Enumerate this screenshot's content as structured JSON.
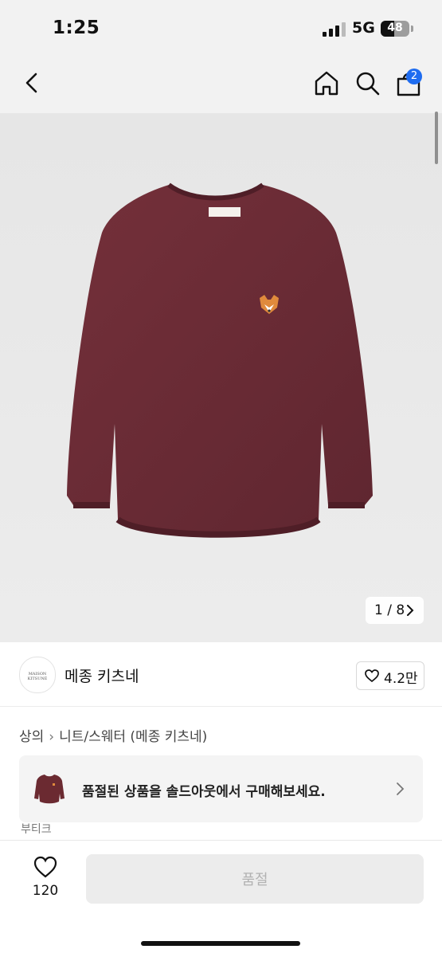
{
  "status_bar": {
    "time": "1:25",
    "network": "5G",
    "battery": "48",
    "battery_level": 0.48
  },
  "nav": {
    "cart_count": "2",
    "icons": [
      "back-icon",
      "home-icon",
      "search-icon",
      "cart-icon"
    ]
  },
  "product": {
    "image_counter": "1 / 8",
    "image_color": "#6b2a31"
  },
  "brand": {
    "name": "메종 키츠네",
    "logo_text": "MAISON KITSUNÉ",
    "likes": "4.2만"
  },
  "breadcrumb": {
    "category": "상의",
    "subcategory": "니트/스웨터 (메종 키츠네)"
  },
  "soldout_banner": {
    "text": "품절된 상품을 솔드아웃에서 구매해보세요."
  },
  "partial_label": "부티크",
  "bottom": {
    "wish_count": "120",
    "buy_label": "품절"
  },
  "colors": {
    "badge": "#1e6cf0",
    "sweater": "#6b2a31",
    "disabled_bg": "#ececec"
  }
}
